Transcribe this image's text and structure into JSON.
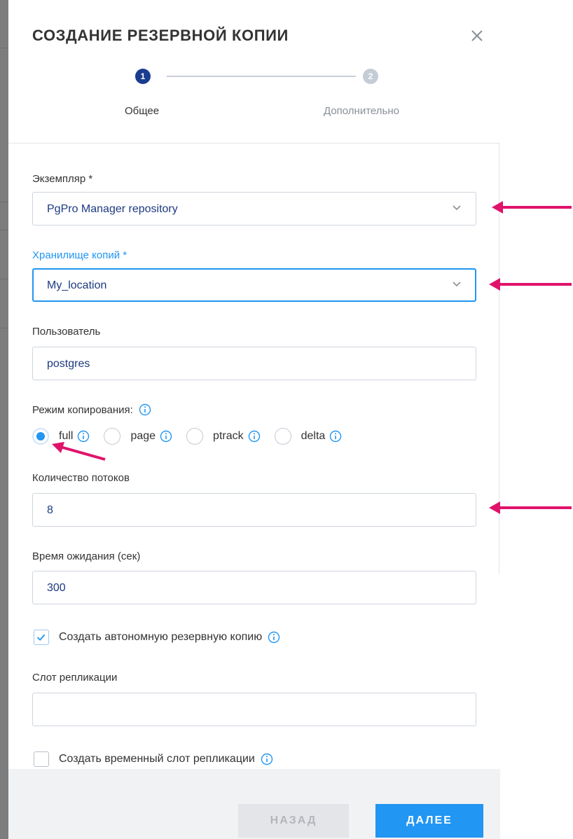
{
  "dialog": {
    "title": "СОЗДАНИЕ РЕЗЕРВНОЙ КОПИИ"
  },
  "stepper": {
    "steps": [
      {
        "number": "1",
        "label": "Общее",
        "active": true
      },
      {
        "number": "2",
        "label": "Дополнительно",
        "active": false
      }
    ]
  },
  "form": {
    "instance": {
      "label": "Экземпляр *",
      "value": "PgPro Manager repository"
    },
    "storage": {
      "label": "Хранилище копий *",
      "value": "My_location"
    },
    "user": {
      "label": "Пользователь",
      "value": "postgres"
    },
    "mode": {
      "label": "Режим копирования:",
      "options": [
        "full",
        "page",
        "ptrack",
        "delta"
      ],
      "selected": "full"
    },
    "threads": {
      "label": "Количество потоков",
      "value": "8"
    },
    "timeout": {
      "label": "Время ожидания (сек)",
      "value": "300"
    },
    "standalone": {
      "label": "Создать автономную резервную копию",
      "checked": true
    },
    "slot": {
      "label": "Слот репликации",
      "value": ""
    },
    "temp_slot": {
      "label": "Создать временный слот репликации",
      "checked": false
    }
  },
  "footer": {
    "back_label": "НАЗАД",
    "next_label": "ДАЛЕЕ"
  },
  "colors": {
    "accent": "#2196f3",
    "step_active": "#1a3d8f",
    "annotation_arrow": "#e0136b"
  }
}
